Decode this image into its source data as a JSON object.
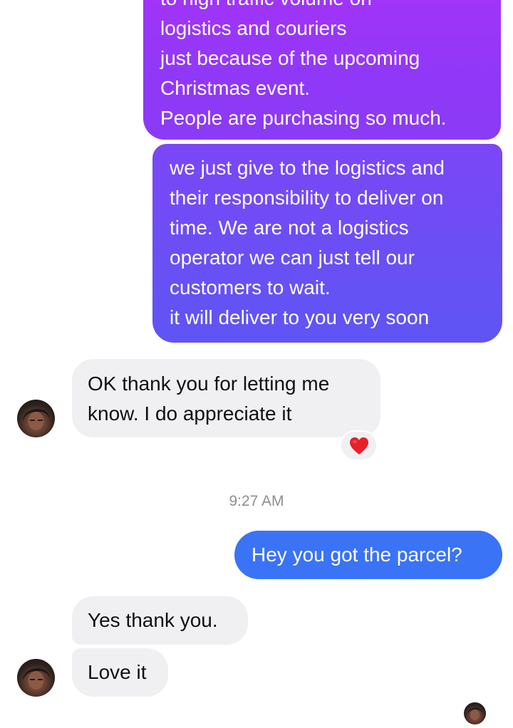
{
  "conversation": {
    "messages": [
      {
        "direction": "outgoing",
        "lines": [
          "to high traffic volume on",
          "logistics and couriers",
          "just because of the upcoming",
          "Christmas event.",
          "People are purchasing so much."
        ]
      },
      {
        "direction": "outgoing",
        "lines": [
          "we just give to the logistics and",
          "their responsibility to deliver on",
          "time. We are not a logistics",
          "operator we can just tell our",
          "customers to wait.",
          "it will deliver to you very soon"
        ]
      },
      {
        "direction": "incoming",
        "lines": [
          "OK thank you for letting me",
          "know. I do appreciate it"
        ],
        "reaction": "heart-icon"
      },
      {
        "direction": "outgoing",
        "lines": [
          "Hey you got the parcel?"
        ]
      },
      {
        "direction": "incoming",
        "lines": [
          "Yes thank you."
        ]
      },
      {
        "direction": "incoming",
        "lines": [
          "Love it"
        ]
      }
    ],
    "timestamp": "9:27 AM"
  },
  "colors": {
    "outgoing_gradient_top": "#a533f9",
    "outgoing_gradient_mid": "#6a4ff5",
    "outgoing_blue": "#3a73f5",
    "incoming_bg": "#f0f0f2",
    "timestamp_text": "#8e8e93",
    "heart": "#e8202a"
  },
  "icons": {
    "reaction": "heart-icon",
    "avatar": "contact-avatar",
    "read_receipt": "read-receipt-avatar"
  }
}
